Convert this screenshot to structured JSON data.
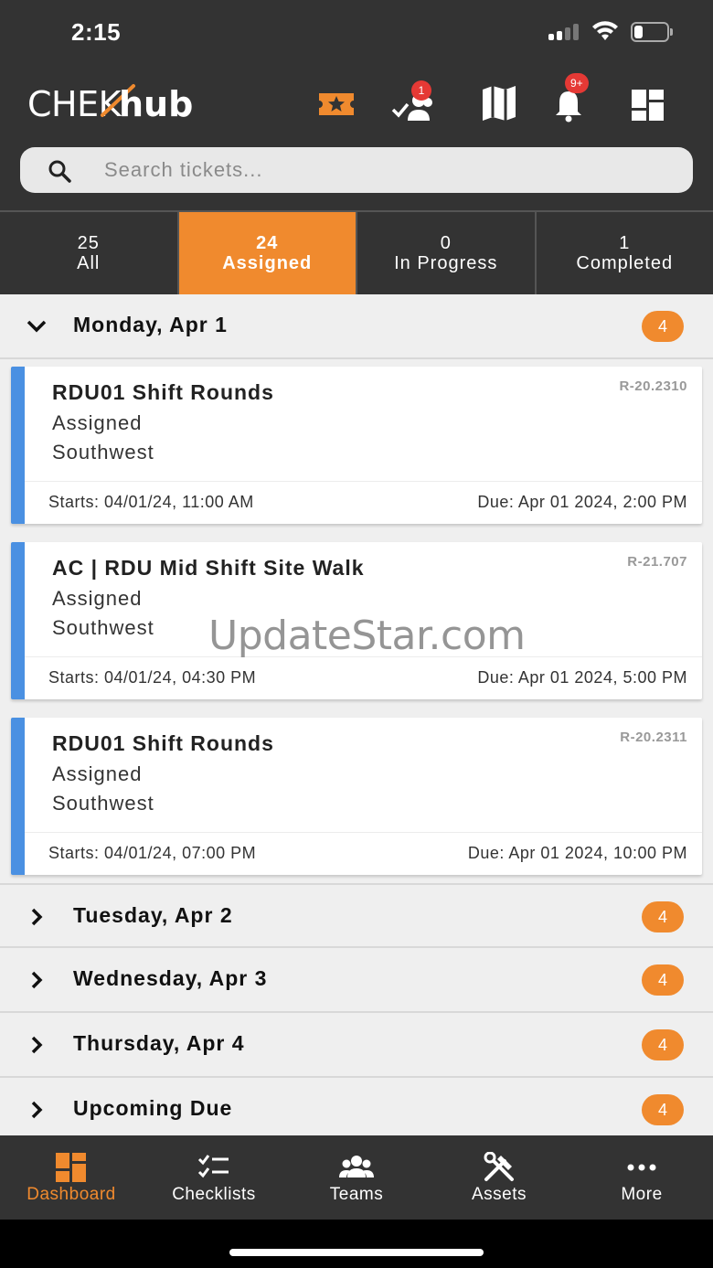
{
  "status_bar": {
    "time": "2:15"
  },
  "header": {
    "logo_chek": "CHEK",
    "logo_hub": "hub",
    "team_badge": "1",
    "notification_badge": "9+",
    "accent_color": "#f08a2e"
  },
  "search": {
    "placeholder": "Search tickets..."
  },
  "tabs": [
    {
      "count": "25",
      "label": "All"
    },
    {
      "count": "24",
      "label": "Assigned"
    },
    {
      "count": "0",
      "label": "In Progress"
    },
    {
      "count": "1",
      "label": "Completed"
    }
  ],
  "groups": [
    {
      "title": "Monday, Apr 1",
      "count": "4"
    },
    {
      "title": "Tuesday, Apr 2",
      "count": "4"
    },
    {
      "title": "Wednesday, Apr 3",
      "count": "4"
    },
    {
      "title": "Thursday, Apr 4",
      "count": "4"
    },
    {
      "title": "Upcoming Due",
      "count": "4"
    }
  ],
  "tickets": [
    {
      "title": "RDU01 Shift Rounds",
      "status": "Assigned",
      "region": "Southwest",
      "ref": "R-20.2310",
      "starts": "Starts: 04/01/24, 11:00 AM",
      "due": "Due: Apr 01 2024, 2:00 PM"
    },
    {
      "title": "AC | RDU Mid Shift Site Walk",
      "status": "Assigned",
      "region": "Southwest",
      "ref": "R-21.707",
      "starts": "Starts: 04/01/24, 04:30 PM",
      "due": "Due: Apr 01 2024, 5:00 PM"
    },
    {
      "title": "RDU01 Shift Rounds",
      "status": "Assigned",
      "region": "Southwest",
      "ref": "R-20.2311",
      "starts": "Starts: 04/01/24, 07:00 PM",
      "due": "Due: Apr 01 2024, 10:00 PM"
    }
  ],
  "watermark": "UpdateStar.com",
  "bottom_nav": [
    {
      "label": "Dashboard",
      "icon": "dashboard-icon"
    },
    {
      "label": "Checklists",
      "icon": "checklist-icon"
    },
    {
      "label": "Teams",
      "icon": "teams-icon"
    },
    {
      "label": "Assets",
      "icon": "tools-icon"
    },
    {
      "label": "More",
      "icon": "more-icon"
    }
  ]
}
